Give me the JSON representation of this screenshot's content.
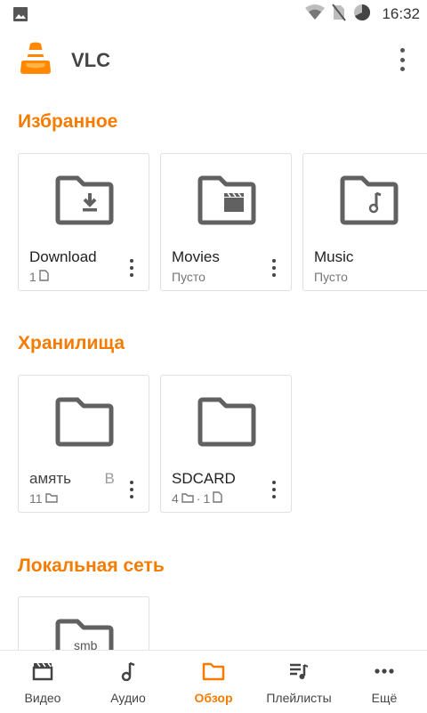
{
  "status_bar": {
    "time": "16:32",
    "icons": [
      "image-icon",
      "wifi-icon",
      "no-sim-icon",
      "battery-icon"
    ]
  },
  "app_bar": {
    "title": "VLC",
    "logo": "vlc-cone-logo",
    "menu_icon": "overflow-menu-icon"
  },
  "colors": {
    "accent": "#f57c00",
    "icon_gray": "#616161",
    "text": "#212121",
    "secondary_text": "#757575"
  },
  "favorites": {
    "title": "Избранное",
    "items": [
      {
        "name": "Download",
        "count": "1",
        "count_icon": "file-icon",
        "folder_icon": "folder-download-icon"
      },
      {
        "name": "Movies",
        "subtitle": "Пусто",
        "folder_icon": "folder-movie-icon"
      },
      {
        "name": "Music",
        "subtitle": "Пусто",
        "folder_icon": "folder-music-icon"
      }
    ]
  },
  "storages": {
    "title": "Хранилища",
    "items": [
      {
        "name_left": "амять",
        "name_right": "В",
        "count": "11",
        "count_icon": "folder-small-icon",
        "folder_icon": "folder-icon"
      },
      {
        "name": "SDCARD",
        "folders": "4",
        "separator": "·",
        "files": "1",
        "folder_icon": "folder-icon"
      }
    ]
  },
  "network": {
    "title": "Локальная сеть",
    "items": [
      {
        "folder_label": "smb",
        "folder_icon": "folder-smb-icon"
      }
    ]
  },
  "bottom_nav": {
    "active_index": 2,
    "items": [
      {
        "label": "Видео",
        "icon": "video-clapper-icon"
      },
      {
        "label": "Аудио",
        "icon": "music-note-icon"
      },
      {
        "label": "Обзор",
        "icon": "folder-browse-icon"
      },
      {
        "label": "Плейлисты",
        "icon": "playlist-icon"
      },
      {
        "label": "Ещё",
        "icon": "more-horiz-icon"
      }
    ]
  }
}
